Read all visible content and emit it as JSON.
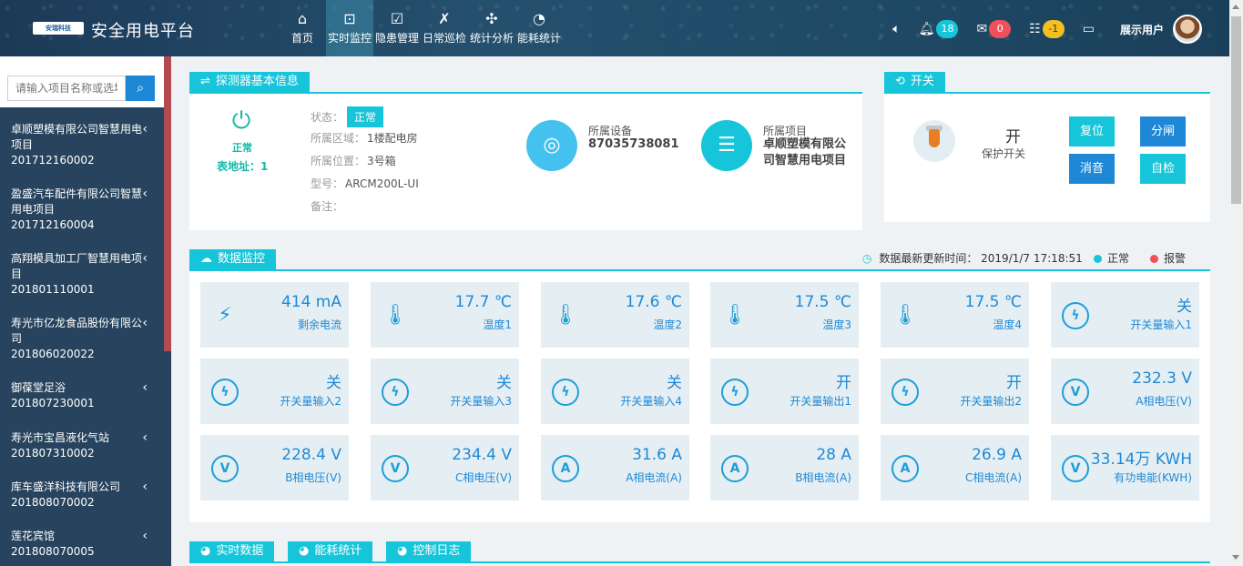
{
  "app": {
    "title": "安全用电平台",
    "logo_text": "安瑞科技"
  },
  "nav": [
    {
      "label": "首页",
      "icon": "⌂"
    },
    {
      "label": "实时监控",
      "icon": "⊡"
    },
    {
      "label": "隐患管理",
      "icon": "☑"
    },
    {
      "label": "日常巡检",
      "icon": "✗"
    },
    {
      "label": "统计分析",
      "icon": "✣"
    },
    {
      "label": "能耗统计",
      "icon": "◔"
    }
  ],
  "header": {
    "bell_count": "18",
    "mail_count": "0",
    "task_count": "-1",
    "user_name": "展示用户"
  },
  "sidebar": {
    "search_placeholder": "请输入项目名称或选址",
    "items": [
      {
        "name": "卓顺塑模有限公司智慧用电项目",
        "code": "201712160002"
      },
      {
        "name": "盈盛汽车配件有限公司智慧用电项目",
        "code": "201712160004"
      },
      {
        "name": "高翔模具加工厂智慧用电项目",
        "code": "201801110001"
      },
      {
        "name": "寿光市亿龙食品股份有限公司",
        "code": "201806020022"
      },
      {
        "name": "御葆堂足浴",
        "code": "201807230001"
      },
      {
        "name": "寿光市宝昌液化气站",
        "code": "201807310002"
      },
      {
        "name": "库车盛洋科技有限公司",
        "code": "201808070002"
      },
      {
        "name": "莲花宾馆",
        "code": "201808070005"
      }
    ]
  },
  "detector": {
    "tab": "探测器基本信息",
    "status_short": "正常",
    "meter_addr": "表地址：1",
    "status_label": "状态：",
    "status_value": "正常",
    "area_label": "所属区域：",
    "area_value": "1楼配电房",
    "pos_label": "所属位置：",
    "pos_value": "3号箱",
    "model_label": "型号：",
    "model_value": "ARCM200L-UI",
    "remark_label": "备注：",
    "device_label": "所属设备",
    "device_value": "87035738081",
    "project_label": "所属项目",
    "project_value_1": "卓顺塑模有限公",
    "project_value_2": "司智慧用电项目"
  },
  "switch": {
    "tab": "开关",
    "state": "开",
    "label": "保护开关",
    "btn_reset": "复位",
    "btn_open": "分闸",
    "btn_mute": "消音",
    "btn_selftest": "自检"
  },
  "monitor": {
    "tab": "数据监控",
    "update_label": "数据最新更新时间：",
    "update_time": "2019/1/7 17:18:51",
    "legend_normal": "正常",
    "legend_alarm": "报警",
    "normal_color": "#16c5d9",
    "alarm_color": "#f0505a",
    "cards": [
      {
        "value": "414 mA",
        "label": "剩余电流",
        "icon": "⚡",
        "icon_name": "lightning-icon"
      },
      {
        "value": "17.7 ℃",
        "label": "温度1",
        "icon": "🌡",
        "icon_name": "thermometer-icon"
      },
      {
        "value": "17.6 ℃",
        "label": "温度2",
        "icon": "🌡",
        "icon_name": "thermometer-icon"
      },
      {
        "value": "17.5 ℃",
        "label": "温度3",
        "icon": "🌡",
        "icon_name": "thermometer-icon"
      },
      {
        "value": "17.5 ℃",
        "label": "温度4",
        "icon": "🌡",
        "icon_name": "thermometer-icon"
      },
      {
        "value": "关",
        "label": "开关量输入1",
        "icon": "ϟ",
        "icon_name": "bolt-circle-icon"
      },
      {
        "value": "关",
        "label": "开关量输入2",
        "icon": "ϟ",
        "icon_name": "bolt-circle-icon"
      },
      {
        "value": "关",
        "label": "开关量输入3",
        "icon": "ϟ",
        "icon_name": "bolt-circle-icon"
      },
      {
        "value": "关",
        "label": "开关量输入4",
        "icon": "ϟ",
        "icon_name": "bolt-circle-icon"
      },
      {
        "value": "开",
        "label": "开关量输出1",
        "icon": "ϟ",
        "icon_name": "bolt-circle-icon"
      },
      {
        "value": "开",
        "label": "开关量输出2",
        "icon": "ϟ",
        "icon_name": "bolt-circle-icon"
      },
      {
        "value": "232.3 V",
        "label": "A相电压(V)",
        "icon": "V",
        "icon_name": "voltage-icon"
      },
      {
        "value": "228.4 V",
        "label": "B相电压(V)",
        "icon": "V",
        "icon_name": "voltage-icon"
      },
      {
        "value": "234.4 V",
        "label": "C相电压(V)",
        "icon": "V",
        "icon_name": "voltage-icon"
      },
      {
        "value": "31.6 A",
        "label": "A相电流(A)",
        "icon": "A",
        "icon_name": "current-icon"
      },
      {
        "value": "28 A",
        "label": "B相电流(A)",
        "icon": "A",
        "icon_name": "current-icon"
      },
      {
        "value": "26.9 A",
        "label": "C相电流(A)",
        "icon": "A",
        "icon_name": "current-icon"
      },
      {
        "value": "33.14万 KWH",
        "label": "有功电能(KWH)",
        "icon": "V",
        "icon_name": "energy-icon"
      }
    ]
  },
  "bottom_tabs": [
    {
      "label": "实时数据"
    },
    {
      "label": "能耗统计"
    },
    {
      "label": "控制日志"
    }
  ]
}
